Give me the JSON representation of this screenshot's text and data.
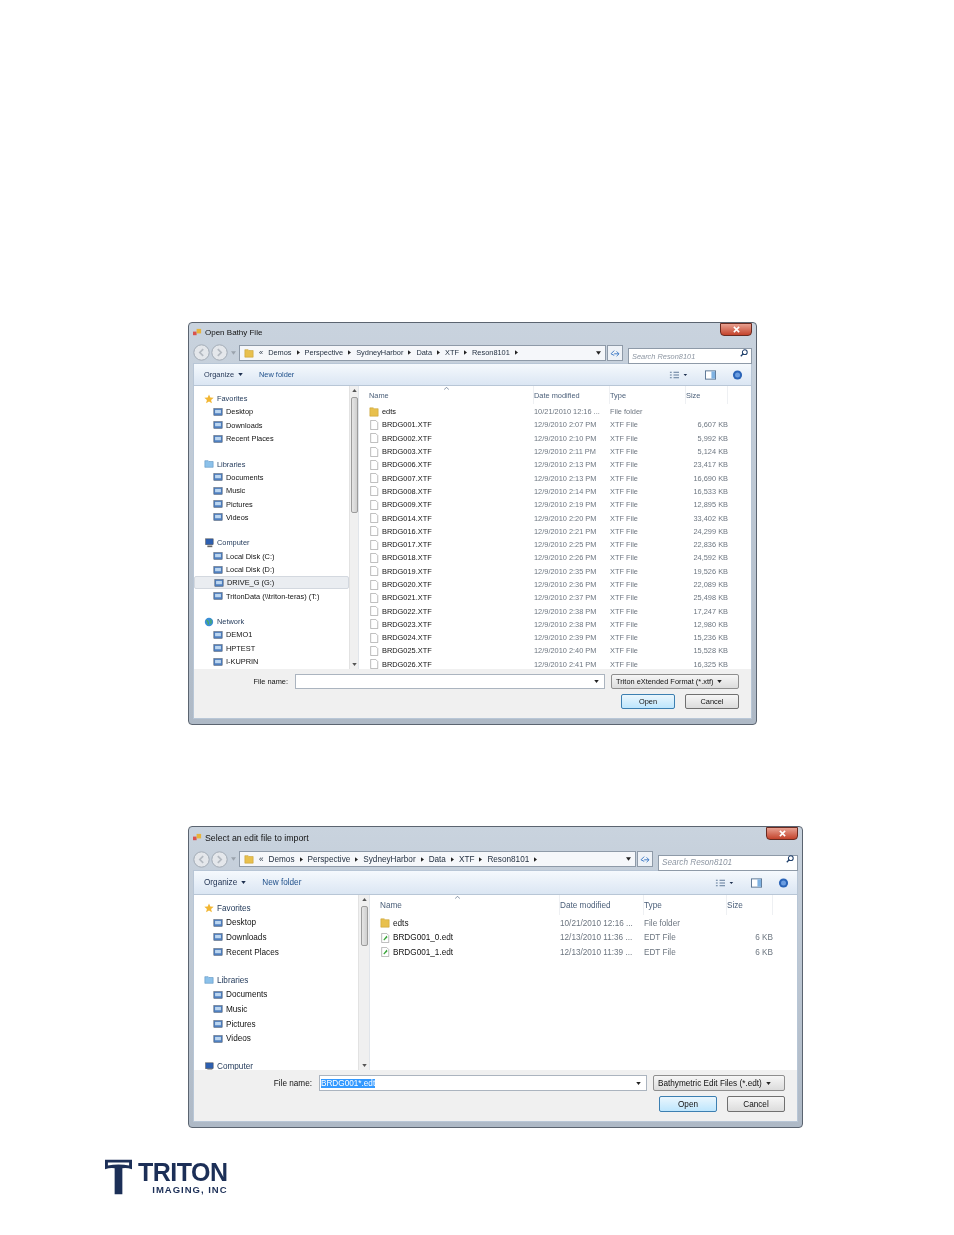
{
  "dialogs": [
    {
      "title": "Open Bathy File",
      "address": {
        "overflow": "«",
        "crumbs": [
          "Demos",
          "Perspective",
          "SydneyHarbor",
          "Data",
          "XTF",
          "Reson8101"
        ]
      },
      "search": {
        "placeholder": "Search Reson8101"
      },
      "toolbar": {
        "organize": "Organize",
        "new_folder": "New folder"
      },
      "nav": [
        {
          "kind": "favorites",
          "label": "Favorites",
          "items": [
            {
              "label": "Desktop",
              "selected": false
            },
            {
              "label": "Downloads",
              "selected": false
            },
            {
              "label": "Recent Places",
              "selected": false
            }
          ]
        },
        {
          "kind": "libraries",
          "label": "Libraries",
          "items": [
            {
              "label": "Documents",
              "selected": false
            },
            {
              "label": "Music",
              "selected": false
            },
            {
              "label": "Pictures",
              "selected": false
            },
            {
              "label": "Videos",
              "selected": false
            }
          ]
        },
        {
          "kind": "computer",
          "label": "Computer",
          "items": [
            {
              "label": "Local Disk (C:)",
              "selected": false
            },
            {
              "label": "Local Disk (D:)",
              "selected": false
            },
            {
              "label": "DRIVE_G (G:)",
              "selected": true
            },
            {
              "label": "TritonData (\\\\triton-teras) (T:)",
              "selected": false
            }
          ]
        },
        {
          "kind": "network",
          "label": "Network",
          "items": [
            {
              "label": "DEMO1",
              "selected": false
            },
            {
              "label": "HPTEST",
              "selected": false
            },
            {
              "label": "I-KUPRIN",
              "selected": false
            }
          ]
        }
      ],
      "columns": [
        "Name",
        "Date modified",
        "Type",
        "Size"
      ],
      "files": [
        {
          "kind": "folder",
          "name": "edts",
          "date": "10/21/2010 12:16 ...",
          "type": "File folder"
        },
        {
          "kind": "file",
          "name": "BRDG001.XTF",
          "date": "12/9/2010 2:07 PM",
          "type": "XTF File",
          "size": "6,607 KB"
        },
        {
          "kind": "file",
          "name": "BRDG002.XTF",
          "date": "12/9/2010 2:10 PM",
          "type": "XTF File",
          "size": "5,992 KB"
        },
        {
          "kind": "file",
          "name": "BRDG003.XTF",
          "date": "12/9/2010 2:11 PM",
          "type": "XTF File",
          "size": "5,124 KB"
        },
        {
          "kind": "file",
          "name": "BRDG006.XTF",
          "date": "12/9/2010 2:13 PM",
          "type": "XTF File",
          "size": "23,417 KB"
        },
        {
          "kind": "file",
          "name": "BRDG007.XTF",
          "date": "12/9/2010 2:13 PM",
          "type": "XTF File",
          "size": "16,690 KB"
        },
        {
          "kind": "file",
          "name": "BRDG008.XTF",
          "date": "12/9/2010 2:14 PM",
          "type": "XTF File",
          "size": "16,533 KB"
        },
        {
          "kind": "file",
          "name": "BRDG009.XTF",
          "date": "12/9/2010 2:19 PM",
          "type": "XTF File",
          "size": "12,895 KB"
        },
        {
          "kind": "file",
          "name": "BRDG014.XTF",
          "date": "12/9/2010 2:20 PM",
          "type": "XTF File",
          "size": "33,402 KB"
        },
        {
          "kind": "file",
          "name": "BRDG016.XTF",
          "date": "12/9/2010 2:21 PM",
          "type": "XTF File",
          "size": "24,299 KB"
        },
        {
          "kind": "file",
          "name": "BRDG017.XTF",
          "date": "12/9/2010 2:25 PM",
          "type": "XTF File",
          "size": "22,836 KB"
        },
        {
          "kind": "file",
          "name": "BRDG018.XTF",
          "date": "12/9/2010 2:26 PM",
          "type": "XTF File",
          "size": "24,592 KB"
        },
        {
          "kind": "file",
          "name": "BRDG019.XTF",
          "date": "12/9/2010 2:35 PM",
          "type": "XTF File",
          "size": "19,526 KB"
        },
        {
          "kind": "file",
          "name": "BRDG020.XTF",
          "date": "12/9/2010 2:36 PM",
          "type": "XTF File",
          "size": "22,089 KB"
        },
        {
          "kind": "file",
          "name": "BRDG021.XTF",
          "date": "12/9/2010 2:37 PM",
          "type": "XTF File",
          "size": "25,498 KB"
        },
        {
          "kind": "file",
          "name": "BRDG022.XTF",
          "date": "12/9/2010 2:38 PM",
          "type": "XTF File",
          "size": "17,247 KB"
        },
        {
          "kind": "file",
          "name": "BRDG023.XTF",
          "date": "12/9/2010 2:38 PM",
          "type": "XTF File",
          "size": "12,980 KB"
        },
        {
          "kind": "file",
          "name": "BRDG024.XTF",
          "date": "12/9/2010 2:39 PM",
          "type": "XTF File",
          "size": "15,236 KB"
        },
        {
          "kind": "file",
          "name": "BRDG025.XTF",
          "date": "12/9/2010 2:40 PM",
          "type": "XTF File",
          "size": "15,528 KB"
        },
        {
          "kind": "file",
          "name": "BRDG026.XTF",
          "date": "12/9/2010 2:41 PM",
          "type": "XTF File",
          "size": "16,325 KB"
        }
      ],
      "file_name": {
        "label": "File name:"
      },
      "filter": "Triton eXtended Format (*.xtf)",
      "buttons": [
        "Open",
        "Cancel"
      ]
    },
    {
      "title": "Select an edit file to import",
      "address": {
        "overflow": "«",
        "crumbs": [
          "Demos",
          "Perspective",
          "SydneyHarbor",
          "Data",
          "XTF",
          "Reson8101"
        ]
      },
      "search": {
        "placeholder": "Search Reson8101"
      },
      "toolbar": {
        "organize": "Organize",
        "new_folder": "New folder"
      },
      "nav": [
        {
          "kind": "favorites",
          "label": "Favorites",
          "items": [
            {
              "label": "Desktop",
              "selected": false
            },
            {
              "label": "Downloads",
              "selected": false
            },
            {
              "label": "Recent Places",
              "selected": false
            }
          ]
        },
        {
          "kind": "libraries",
          "label": "Libraries",
          "items": [
            {
              "label": "Documents",
              "selected": false
            },
            {
              "label": "Music",
              "selected": false
            },
            {
              "label": "Pictures",
              "selected": false
            },
            {
              "label": "Videos",
              "selected": false
            }
          ]
        },
        {
          "kind": "computer",
          "label": "Computer"
        }
      ],
      "columns": [
        "Name",
        "Date modified",
        "Type",
        "Size"
      ],
      "files": [
        {
          "kind": "folder",
          "name": "edts",
          "date": "10/21/2010 12:16 ...",
          "type": "File folder"
        },
        {
          "kind": "edit",
          "name": "BRDG001_0.edt",
          "date": "12/13/2010 11:36 ...",
          "type": "EDT File",
          "size": "6 KB"
        },
        {
          "kind": "edit",
          "name": "BRDG001_1.edt",
          "date": "12/13/2010 11:39 ...",
          "type": "EDT File",
          "size": "6 KB"
        }
      ],
      "file_name": {
        "label": "File name:",
        "value": "BRDG001*.edt",
        "text_selected": true
      },
      "filter": "Bathymetric Edit Files (*.edt)",
      "buttons": [
        "Open",
        "Cancel"
      ]
    }
  ],
  "logo": {
    "name": "TRITON",
    "tagline": "IMAGING, INC"
  }
}
